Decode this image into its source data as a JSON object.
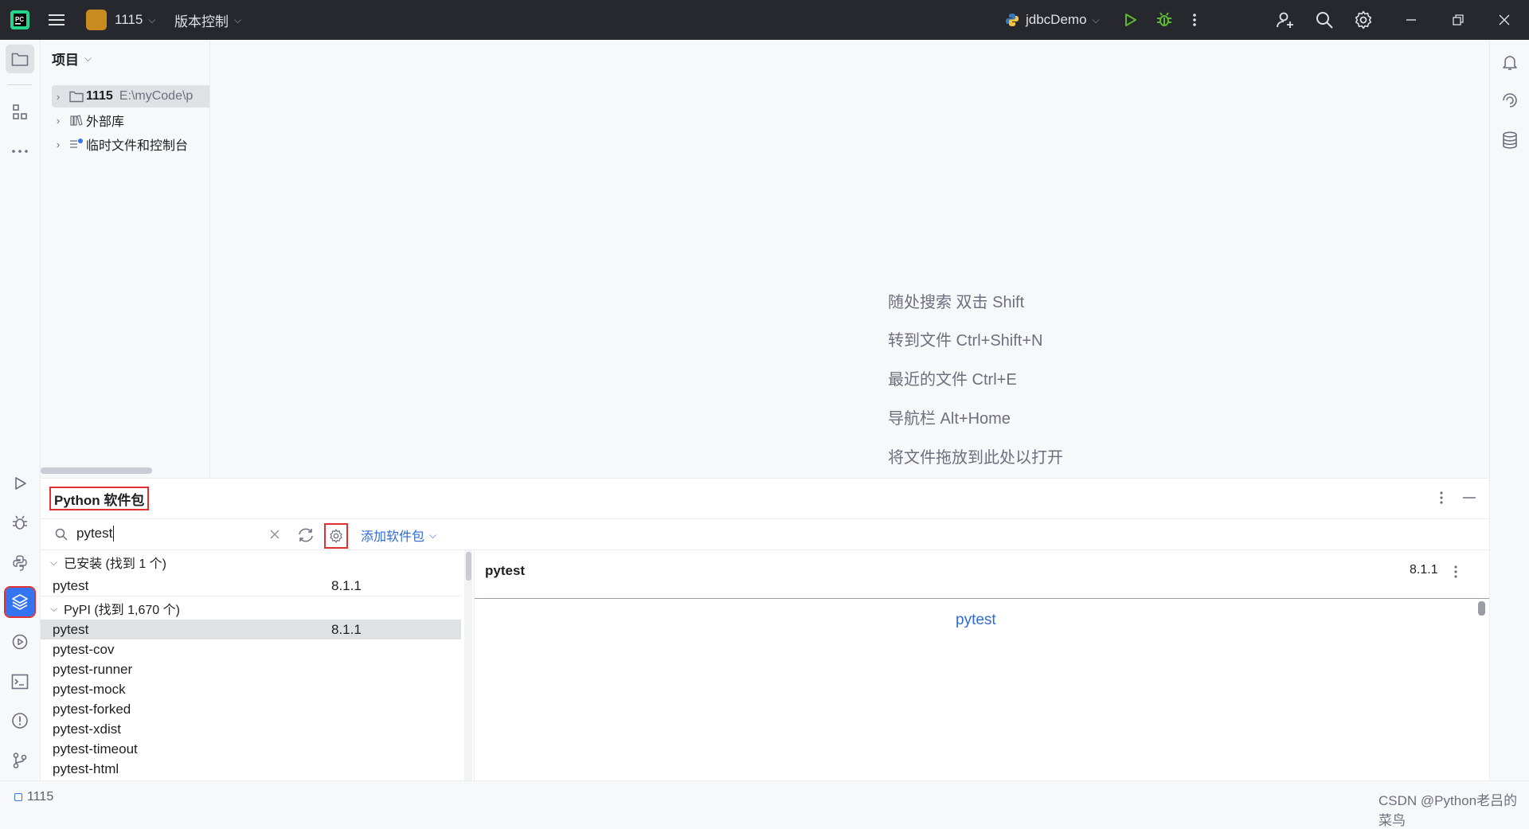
{
  "titlebar": {
    "project_name": "1115",
    "vcs_label": "版本控制",
    "run_config": "jdbcDemo"
  },
  "project_panel": {
    "title": "项目",
    "tree": [
      {
        "label": "1115",
        "path": "E:\\myCode\\p"
      },
      {
        "label": "外部库"
      },
      {
        "label": "临时文件和控制台"
      }
    ]
  },
  "editor": {
    "hints": [
      "随处搜索 双击 Shift",
      "转到文件 Ctrl+Shift+N",
      "最近的文件 Ctrl+E",
      "导航栏 Alt+Home",
      "将文件拖放到此处以打开"
    ]
  },
  "packages": {
    "title": "Python 软件包",
    "search_value": "pytest",
    "add_package_label": "添加软件包",
    "installed_group": "已安装 (找到 1 个)",
    "installed": [
      {
        "name": "pytest",
        "version": "8.1.1"
      }
    ],
    "pypi_group": "PyPI (找到 1,670 个)",
    "pypi": [
      {
        "name": "pytest",
        "version": "8.1.1",
        "selected": true
      },
      {
        "name": "pytest-cov",
        "version": ""
      },
      {
        "name": "pytest-runner",
        "version": ""
      },
      {
        "name": "pytest-mock",
        "version": ""
      },
      {
        "name": "pytest-forked",
        "version": ""
      },
      {
        "name": "pytest-xdist",
        "version": ""
      },
      {
        "name": "pytest-timeout",
        "version": ""
      },
      {
        "name": "pytest-html",
        "version": ""
      }
    ],
    "detail": {
      "name": "pytest",
      "version": "8.1.1",
      "link": "pytest"
    }
  },
  "statusbar": {
    "project": "1115",
    "watermark": "CSDN @Python老吕的菜鸟"
  },
  "colors": {
    "accent": "#3574f0",
    "highlight_box": "#e03131",
    "project_badge": "#c98a1f",
    "run_green": "#5fb832",
    "link": "#2f6bd8"
  }
}
